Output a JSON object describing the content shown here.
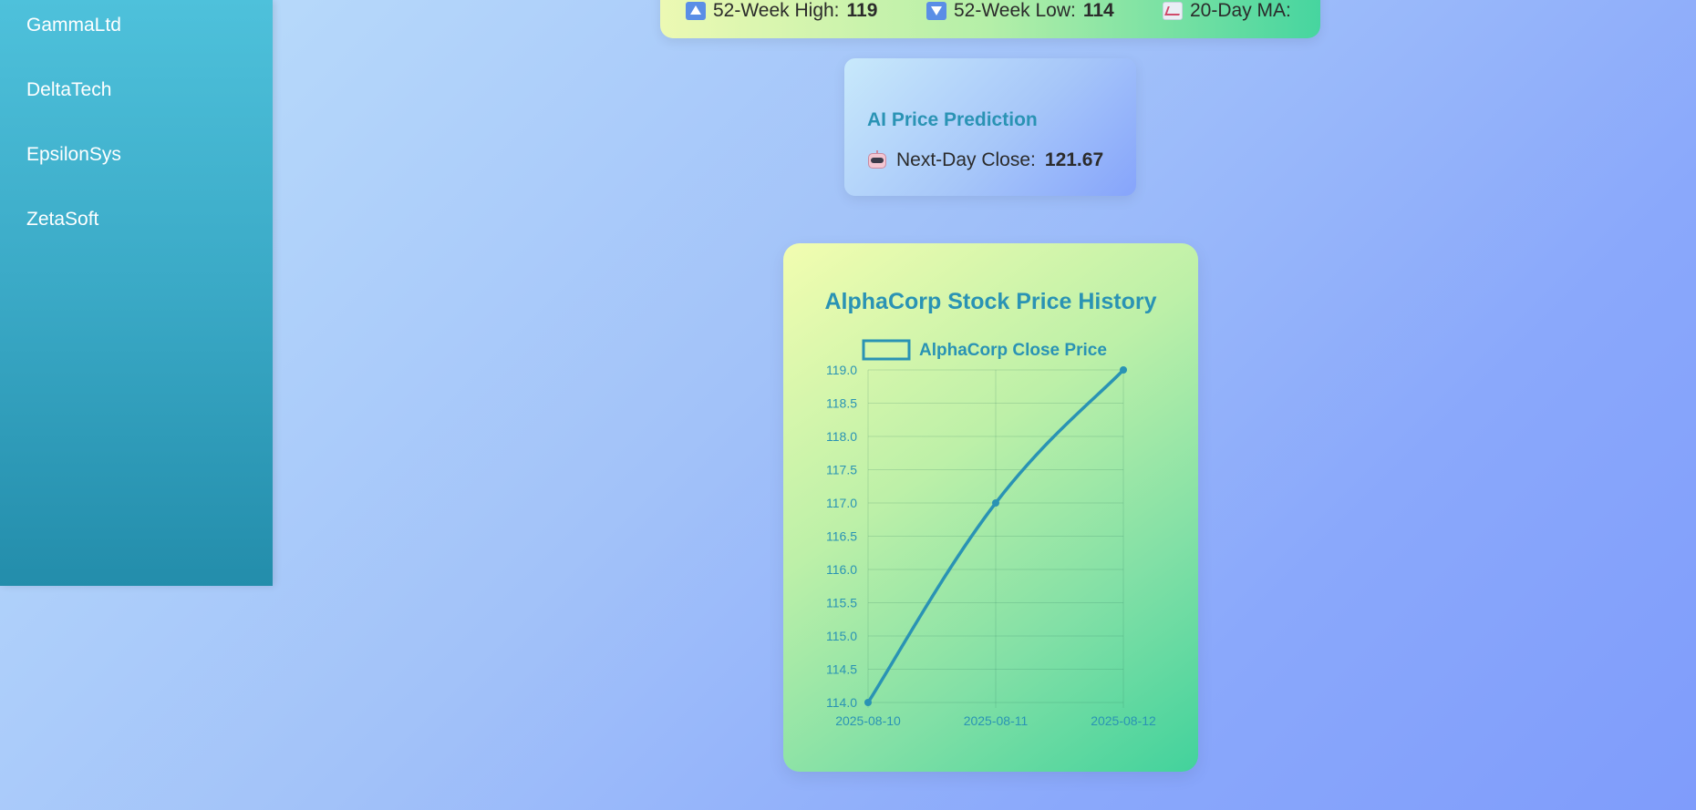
{
  "sidebar": {
    "items": [
      {
        "label": "GammaLtd"
      },
      {
        "label": "DeltaTech"
      },
      {
        "label": "EpsilonSys"
      },
      {
        "label": "ZetaSoft"
      }
    ]
  },
  "stats": {
    "high_label": "52-Week High:",
    "high_value": "119",
    "low_label": "52-Week Low:",
    "low_value": "114",
    "ma_label": "20-Day MA:",
    "icons": [
      "up-arrow-icon",
      "down-arrow-icon",
      "trend-chart-icon"
    ]
  },
  "prediction": {
    "title": "AI Price Prediction",
    "label": "Next-Day Close:",
    "value": "121.67",
    "icon": "robot-icon"
  },
  "chart": {
    "title": "AlphaCorp Stock Price History"
  },
  "chart_data": {
    "type": "line",
    "title": "AlphaCorp Stock Price History",
    "x": [
      "2025-08-10",
      "2025-08-11",
      "2025-08-12"
    ],
    "series": [
      {
        "name": "AlphaCorp Close Price",
        "values": [
          114,
          117,
          119
        ]
      }
    ],
    "ylim": [
      114,
      119
    ],
    "yticks": [
      "114.0",
      "114.5",
      "115.0",
      "115.5",
      "116.0",
      "116.5",
      "117.0",
      "117.5",
      "118.0",
      "118.5",
      "119.0"
    ],
    "legend": "top",
    "grid": true,
    "line_color": "#2a93b4"
  }
}
